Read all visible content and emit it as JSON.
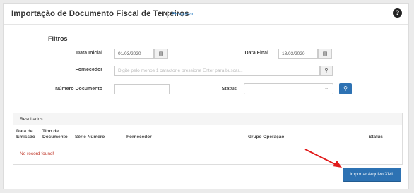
{
  "header": {
    "title": "Importação de Documento Fiscal de Terceiros",
    "search_link": "Pesquisar",
    "help_glyph": "?"
  },
  "filters": {
    "title": "Filtros",
    "data_inicial": {
      "label": "Data Inicial",
      "value": "01/03/2020",
      "icon": "calendar-icon"
    },
    "data_final": {
      "label": "Data Final",
      "value": "18/03/2020",
      "icon": "calendar-icon"
    },
    "fornecedor": {
      "label": "Fornecedor",
      "placeholder": "Digite pelo menos 1 caractor e pressione Enter para buscar...",
      "icon": "search-icon"
    },
    "numero_documento": {
      "label": "Número Documento",
      "value": ""
    },
    "status": {
      "label": "Status",
      "value": ""
    }
  },
  "results": {
    "title": "Resultados",
    "columns": [
      {
        "line1": "Data de",
        "line2": "Emissão"
      },
      {
        "line1": "Tipo de",
        "line2": "Documento"
      },
      {
        "line1": "",
        "line2": "Série Número"
      },
      {
        "line1": "",
        "line2": "Fornecedor"
      },
      {
        "line1": "",
        "line2": "Grupo Operação"
      },
      {
        "line1": "",
        "line2": "Status"
      }
    ],
    "empty_message": "No record found!"
  },
  "actions": {
    "import_label": "Importar Arquivo XML"
  },
  "colors": {
    "primary": "#2d72b3",
    "link": "#3a87c8",
    "error_text": "#c0392b",
    "annotation_arrow": "#e11b1b"
  }
}
